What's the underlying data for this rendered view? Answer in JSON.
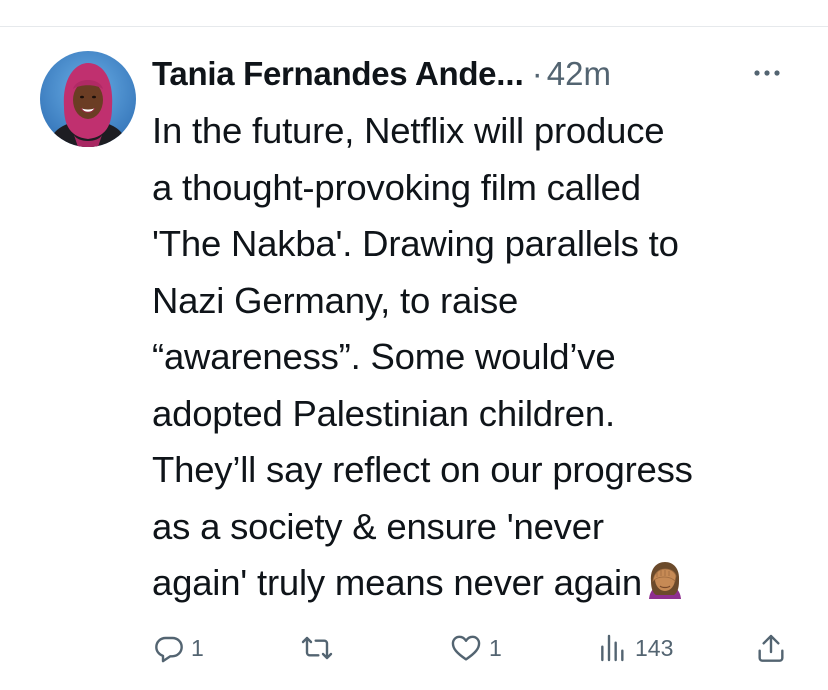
{
  "tweet": {
    "author_name": "Tania Fernandes Ande",
    "name_truncation": "...",
    "separator": "·",
    "timestamp": "42m",
    "text_lines": [
      "In the future, Netflix will produce",
      "a thought-provoking film called",
      "'The Nakba'. Drawing parallels to",
      "Nazi Germany, to raise",
      "“awareness”. Some would’ve",
      "adopted Palestinian children.",
      "They’ll say reflect on our progress",
      "as a society & ensure 'never",
      "again' truly means never again"
    ],
    "trailing_emoji": "face-palm-emoji"
  },
  "actions": {
    "reply_count": "1",
    "retweet_count": "",
    "like_count": "1",
    "views_count": "143"
  },
  "icons": {
    "more": "more-options-icon",
    "reply": "reply-icon",
    "retweet": "retweet-icon",
    "like": "heart-icon",
    "views": "views-icon",
    "share": "share-icon"
  },
  "colors": {
    "text_primary": "#0f1419",
    "text_secondary": "#536471",
    "divider": "#e6e9ec",
    "avatar_background": "#3a7fc4",
    "avatar_hijab": "#c0306f"
  }
}
